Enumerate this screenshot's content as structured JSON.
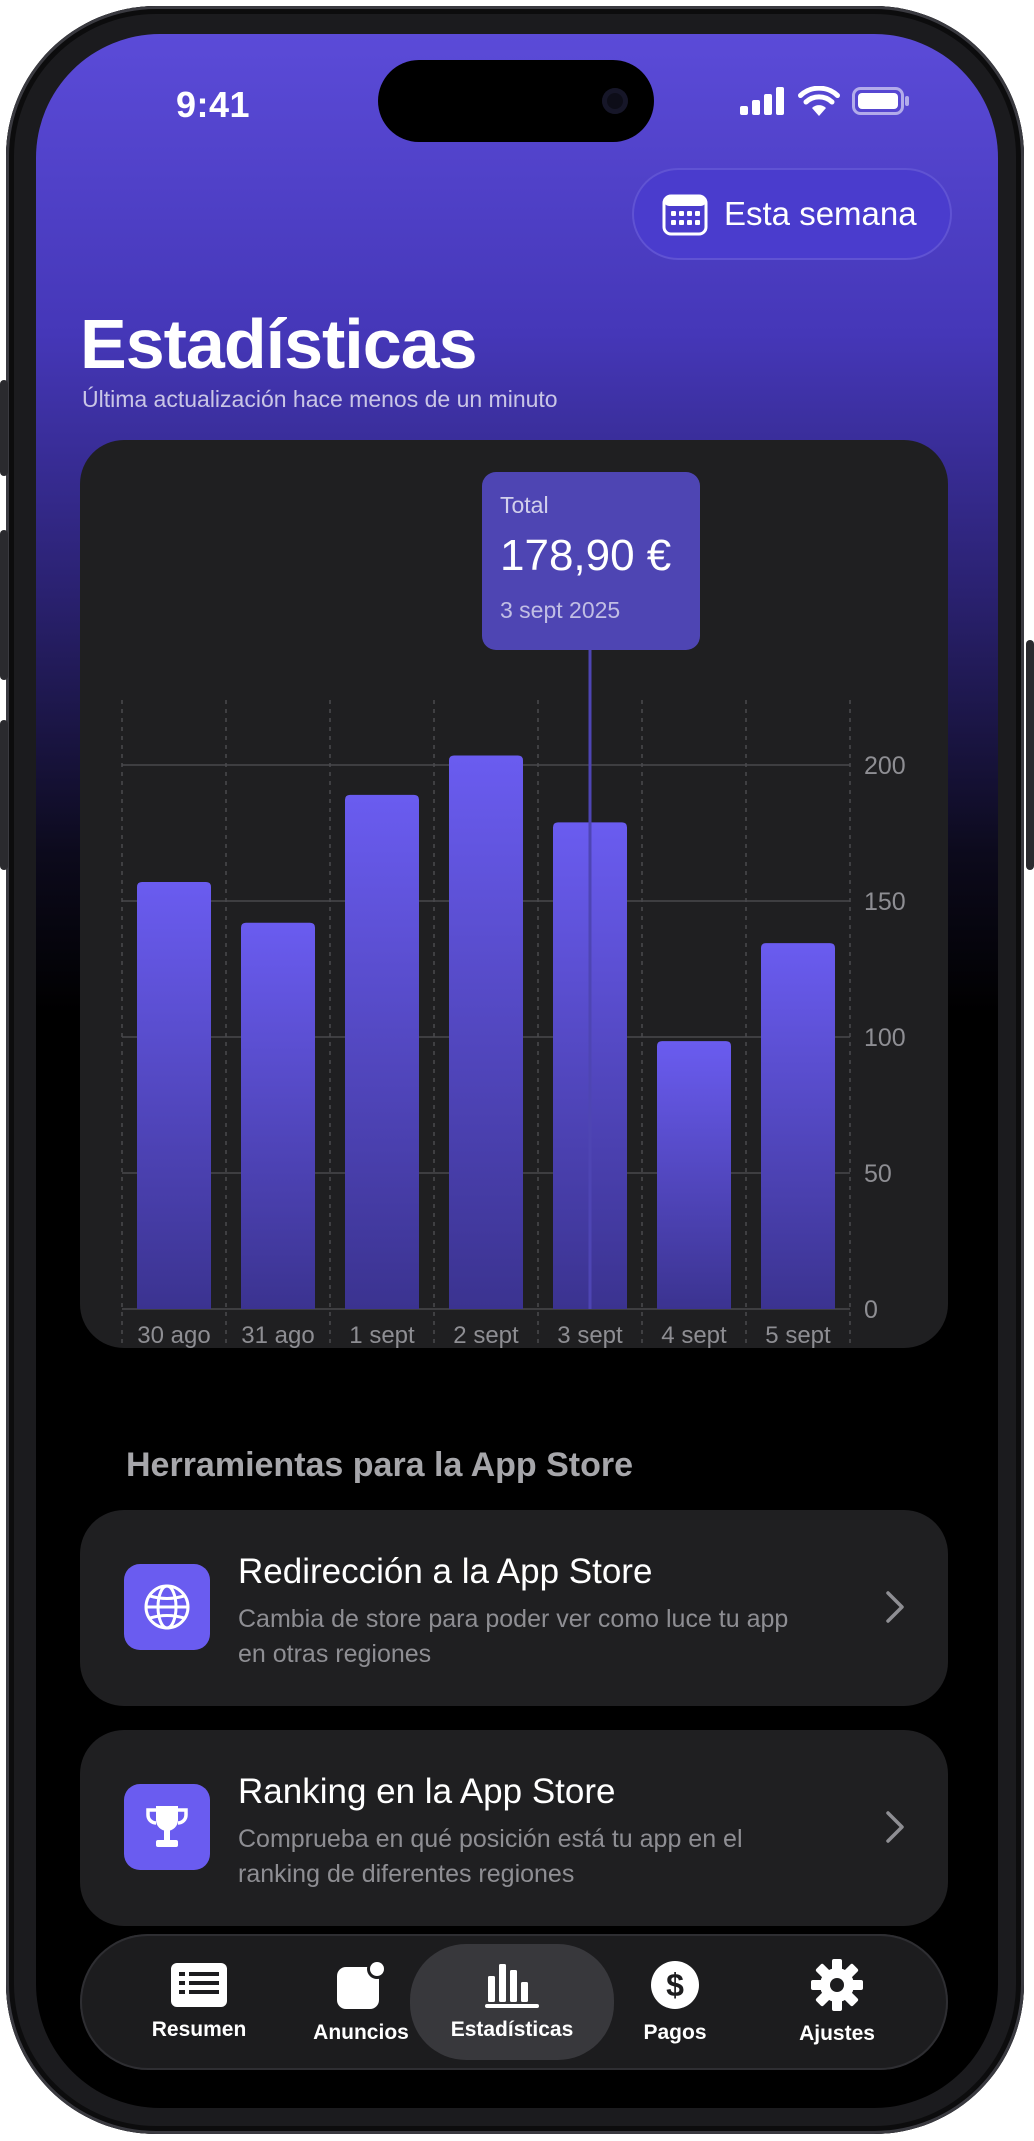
{
  "status_bar": {
    "time": "9:41"
  },
  "header": {
    "period_button_label": "Esta semana",
    "title": "Estadísticas",
    "subtitle": "Última actualización hace menos de un minuto"
  },
  "tooltip": {
    "label": "Total",
    "value": "178,90 €",
    "date": "3 sept 2025"
  },
  "chart_data": {
    "type": "bar",
    "categories": [
      "30 ago",
      "31 ago",
      "1 sept",
      "2 sept",
      "3 sept",
      "4 sept",
      "5 sept"
    ],
    "values": [
      157,
      142,
      189,
      203.5,
      178.9,
      98.5,
      134.5
    ],
    "y_ticks": [
      0,
      50,
      100,
      150,
      200
    ],
    "ylim": [
      0,
      225
    ],
    "selected_index": 4,
    "grid": true,
    "bar_color": "#6a5cf0"
  },
  "tools": {
    "section_title": "Herramientas para la App Store",
    "items": [
      {
        "icon": "globe-icon",
        "title": "Redirección a la App Store",
        "desc": "Cambia de store para poder ver como luce tu app en otras regiones"
      },
      {
        "icon": "trophy-icon",
        "title": "Ranking en la App Store",
        "desc": "Comprueba en qué posición está tu app en el ranking de diferentes regiones"
      }
    ]
  },
  "tab_bar": {
    "active_index": 2,
    "items": [
      {
        "icon": "list-icon",
        "label": "Resumen"
      },
      {
        "icon": "announcement-icon",
        "label": "Anuncios"
      },
      {
        "icon": "bar-chart-icon",
        "label": "Estadísticas"
      },
      {
        "icon": "dollar-icon",
        "label": "Pagos"
      },
      {
        "icon": "gear-icon",
        "label": "Ajustes"
      }
    ]
  },
  "colors": {
    "accent": "#6a5cf0",
    "header_gradient_top": "#5b4bd8",
    "background": "#000000"
  }
}
